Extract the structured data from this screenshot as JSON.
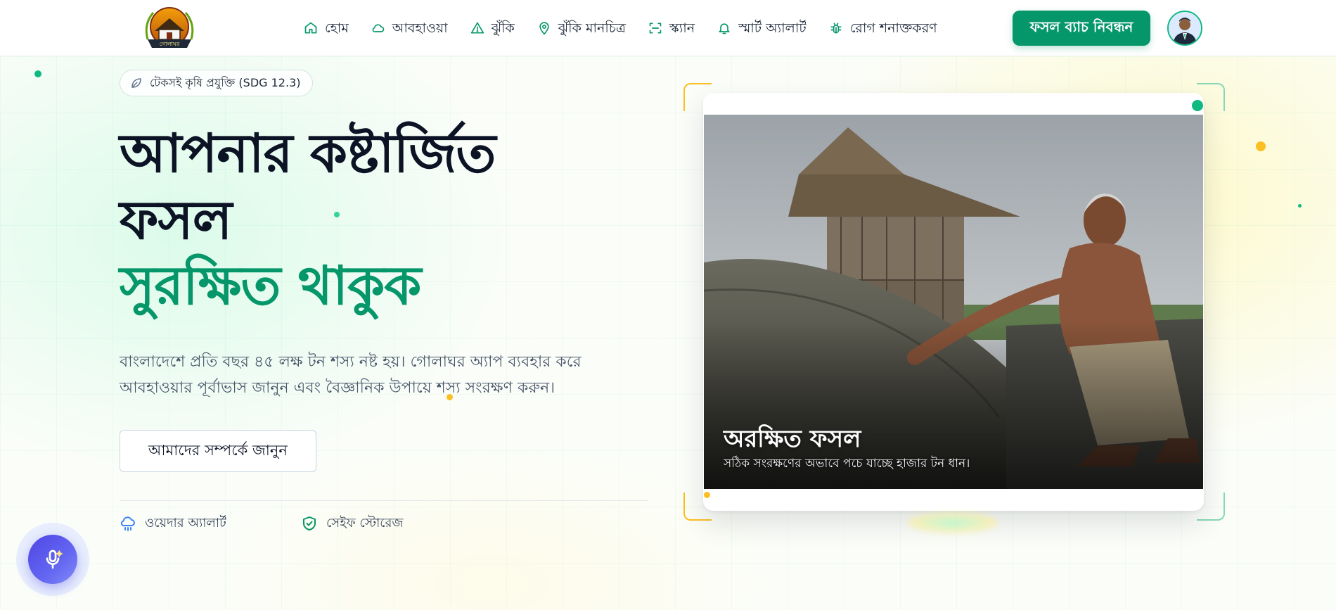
{
  "header": {
    "logo_icon": "golaghor-logo",
    "logo_text": "গোলাঘর",
    "nav": [
      {
        "label": "হোম",
        "icon": "home-icon"
      },
      {
        "label": "আবহাওয়া",
        "icon": "cloud-icon"
      },
      {
        "label": "ঝুঁকি",
        "icon": "warning-icon"
      },
      {
        "label": "ঝুঁকি মানচিত্র",
        "icon": "map-pin-icon"
      },
      {
        "label": "স্ক্যান",
        "icon": "scan-icon"
      },
      {
        "label": "স্মার্ট অ্যালার্ট",
        "icon": "bell-icon"
      },
      {
        "label": "রোগ শনাক্তকরণ",
        "icon": "bug-icon"
      }
    ],
    "cta_label": "ফসল ব্যাচ নিবন্ধন",
    "avatar_icon": "user-avatar"
  },
  "hero": {
    "badge": "টেকসই কৃষি প্রযুক্তি (SDG 12.3)",
    "title_line1": "আপনার কষ্টার্জিত",
    "title_line2": "ফসল",
    "title_line3": "সুরক্ষিত থাকুক",
    "desc_line1": "বাংলাদেশে প্রতি বছর ৪৫ লক্ষ টন শস্য নষ্ট হয়। গোলাঘর অ্যাপ ব্যবহার করে",
    "desc_line2": "আবহাওয়ার পূর্বাভাস জানুন এবং বৈজ্ঞানিক উপায়ে শস্য সংরক্ষণ করুন।",
    "about_button": "আমাদের সম্পর্কে জানুন",
    "features": [
      {
        "label": "ওয়েদার অ্যালার্ট",
        "icon": "cloud-rain-icon"
      },
      {
        "label": "সেইফ স্টোরেজ",
        "icon": "shield-check-icon"
      }
    ],
    "image": {
      "caption_title": "অরক্ষিত ফসল",
      "caption_subtitle": "সঠিক সংরক্ষণের অভাবে পচে যাচ্ছে হাজার টন ধান।"
    }
  },
  "voice_button_icon": "microphone-icon",
  "colors": {
    "primary": "#059669",
    "heading": "#0b1324",
    "accent_yellow": "#fbbf24",
    "voice": "#4f46e5"
  }
}
